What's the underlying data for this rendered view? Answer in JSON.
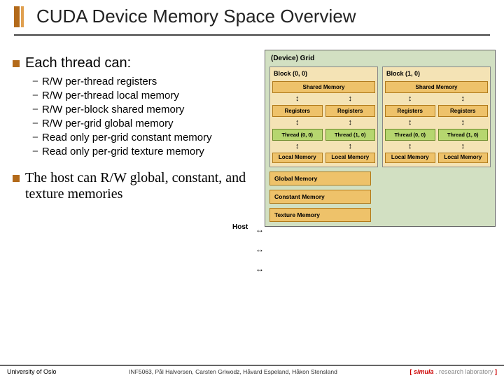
{
  "title": "CUDA Device Memory Space Overview",
  "bullet1": "Each thread can:",
  "subs": [
    {
      "pre": "R/W per-thread ",
      "kw": "registers"
    },
    {
      "pre": "R/W per-thread ",
      "kw": "local memory"
    },
    {
      "pre": "R/W per-block ",
      "kw": "shared memory"
    },
    {
      "pre": "R/W per-grid ",
      "kw": "global memory"
    },
    {
      "pre": "Read only per-grid ",
      "kw": "constant memory"
    },
    {
      "pre": "Read only per-grid ",
      "kw": "texture memory"
    }
  ],
  "bullet2": {
    "p1": "The host can R/W ",
    "kw1": "global",
    "p2": ", ",
    "kw2": "constant",
    "p3": ", and ",
    "kw3": "texture",
    "p4": " memories"
  },
  "diagram": {
    "grid_title": "(Device) Grid",
    "blocks": [
      {
        "title": "Block (0, 0)",
        "shared": "Shared Memory",
        "reg": "Registers",
        "threads": [
          "Thread (0, 0)",
          "Thread (1, 0)"
        ],
        "local": "Local Memory"
      },
      {
        "title": "Block (1, 0)",
        "shared": "Shared Memory",
        "reg": "Registers",
        "threads": [
          "Thread (0, 0)",
          "Thread (1, 0)"
        ],
        "local": "Local Memory"
      }
    ],
    "global_mem": "Global Memory",
    "constant_mem": "Constant Memory",
    "texture_mem": "Texture Memory",
    "host": "Host"
  },
  "footer": {
    "left": "University of Oslo",
    "mid": "INF5063, Pål Halvorsen, Carsten Griwodz, Håvard Espeland, Håkon Stensland",
    "right_brackets": [
      "[ ",
      " ]"
    ],
    "right_sim": "simula",
    "right_rl": " . research laboratory"
  }
}
